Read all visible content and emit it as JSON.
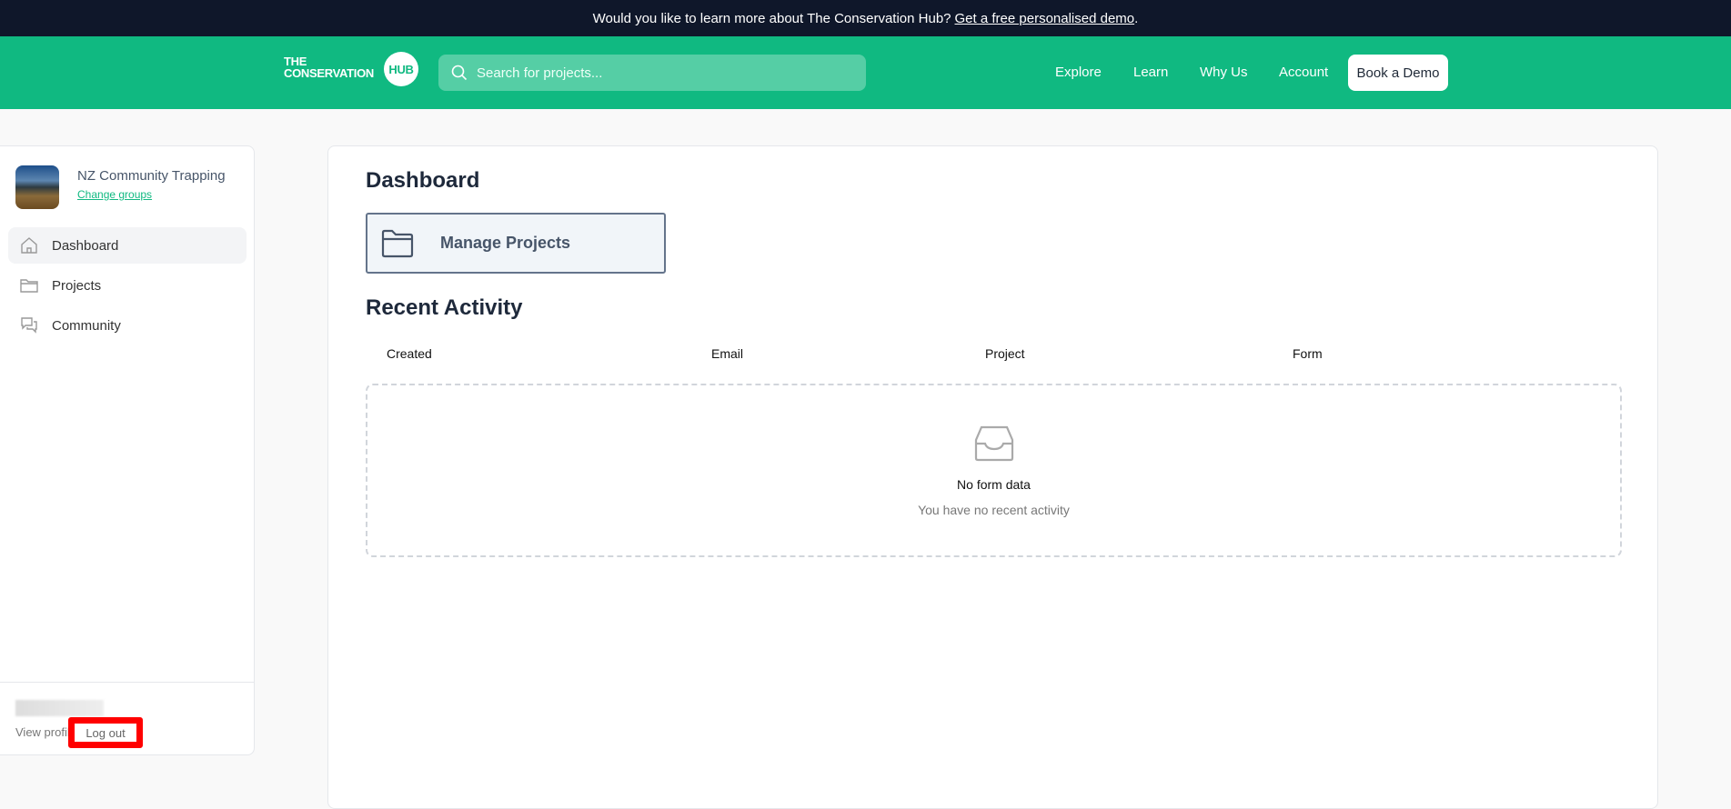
{
  "banner": {
    "text": "Would you like to learn more about The Conservation Hub?",
    "link": "Get a free personalised demo",
    "suffix": "."
  },
  "header": {
    "logo": {
      "line1": "THE",
      "line2": "CONSERVATION",
      "badge": "HUB"
    },
    "search_placeholder": "Search for projects...",
    "nav": [
      "Explore",
      "Learn",
      "Why Us",
      "Account"
    ],
    "cta": "Book a Demo"
  },
  "colors": {
    "brand": "#10b981",
    "banner": "#0f172a",
    "highlight": "#ff0000"
  },
  "sidebar": {
    "group_name": "NZ Community Trapping",
    "change_groups": "Change groups",
    "items": [
      {
        "label": "Dashboard",
        "icon": "home-icon",
        "active": true
      },
      {
        "label": "Projects",
        "icon": "folder-icon"
      },
      {
        "label": "Community",
        "icon": "chat-icon"
      }
    ],
    "view_profile": "View profile",
    "logout": "Log out"
  },
  "main": {
    "title": "Dashboard",
    "manage_projects": "Manage Projects",
    "recent_title": "Recent Activity",
    "columns": [
      "Created",
      "Email",
      "Project",
      "Form"
    ],
    "empty_title": "No form data",
    "empty_subtitle": "You have no recent activity"
  }
}
